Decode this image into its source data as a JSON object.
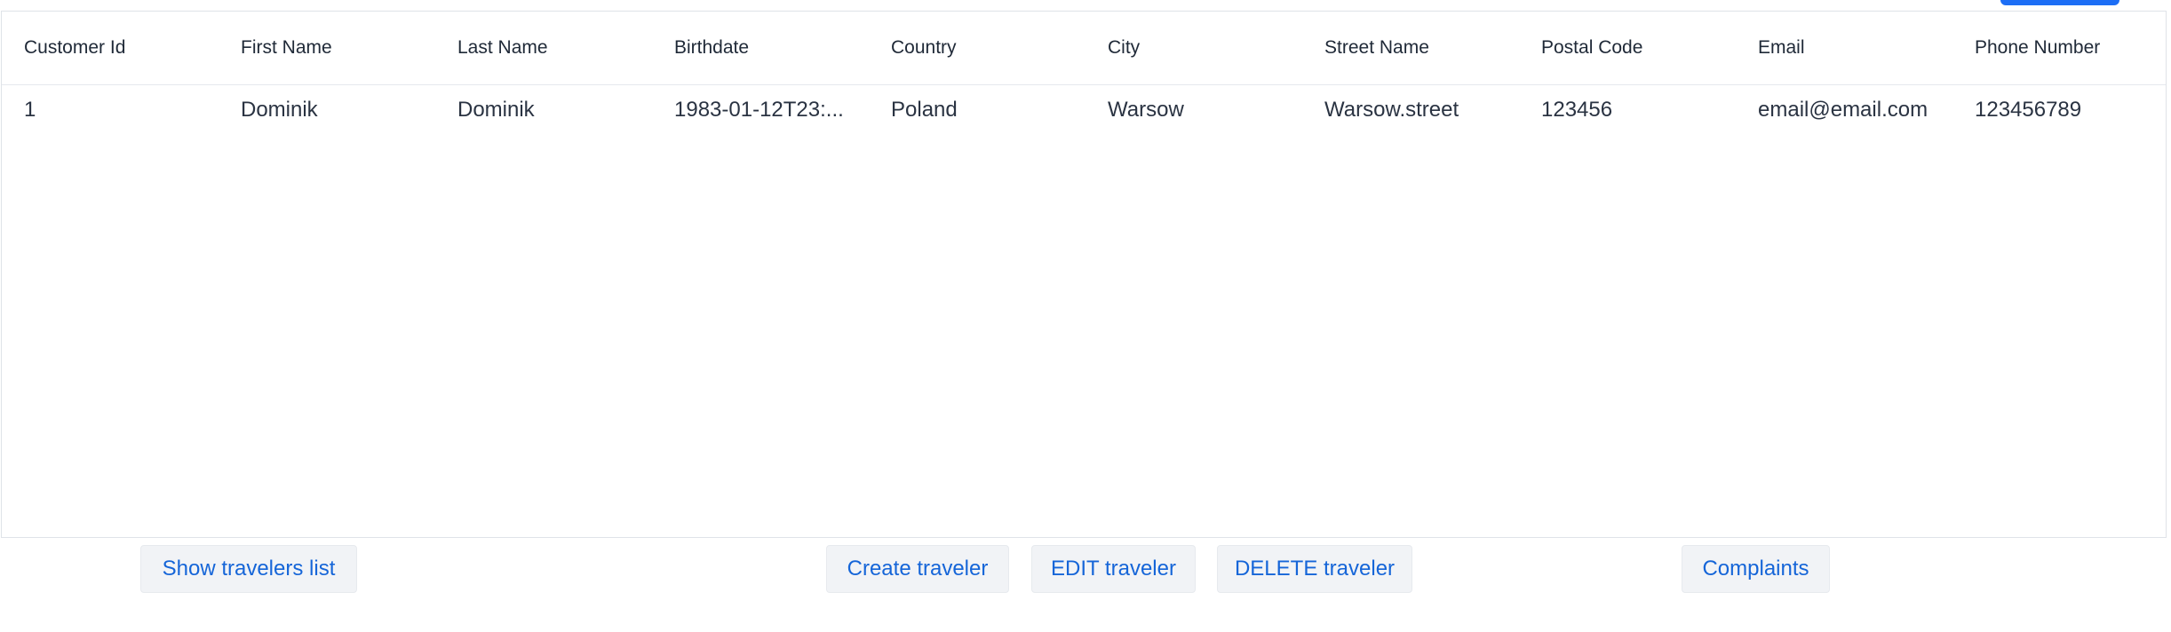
{
  "table": {
    "columns": [
      "Customer Id",
      "First Name",
      "Last Name",
      "Birthdate",
      "Country",
      "City",
      "Street Name",
      "Postal Code",
      "Email",
      "Phone Number"
    ],
    "rows": [
      [
        "1",
        "Dominik",
        "Dominik",
        "1983-01-12T23:...",
        "Poland",
        "Warsow",
        "Warsow.street",
        "123456",
        "email@email.com",
        "123456789"
      ]
    ]
  },
  "actions": {
    "show_travelers_list": "Show travelers list",
    "create_traveler": "Create traveler",
    "edit_traveler": "EDIT traveler",
    "delete_traveler": "DELETE traveler",
    "complaints": "Complaints"
  },
  "colors": {
    "accent": "#1d6ef5",
    "button_text": "#1565d8",
    "button_bg": "#f1f3f6"
  }
}
